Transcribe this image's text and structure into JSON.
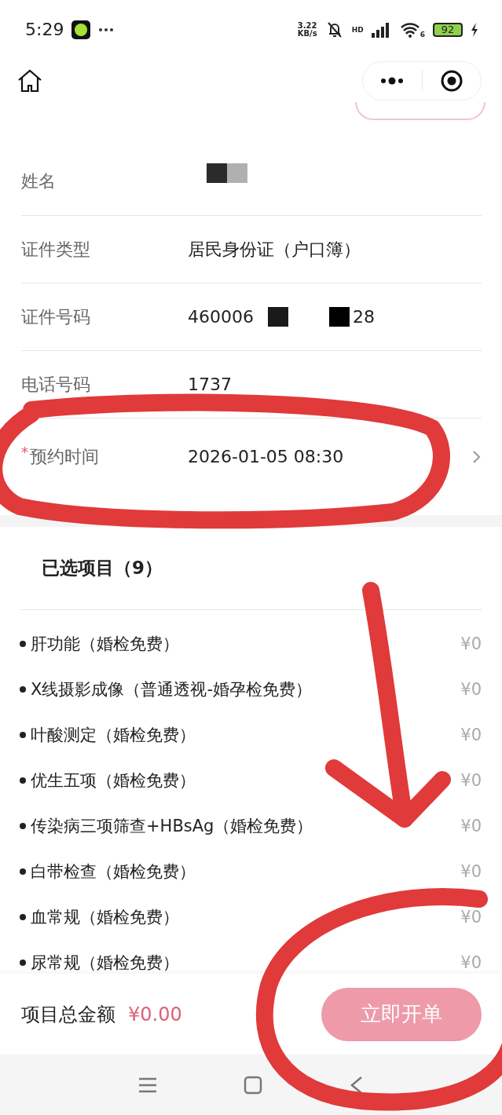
{
  "status_bar": {
    "time": "5:29",
    "net_speed": "3.22",
    "net_unit": "KB/s",
    "signal_label": "HD",
    "wifi_label": "6",
    "battery": "92"
  },
  "form": {
    "rows": [
      {
        "kind": "redacted",
        "label": "姓名",
        "chevron": false
      },
      {
        "kind": "text",
        "label": "证件类型",
        "value": "居民身份证（户口簿）",
        "chevron": false
      },
      {
        "kind": "masked",
        "label": "证件号码",
        "value": "460006",
        "tail": "28",
        "chevron": false
      },
      {
        "kind": "text",
        "label": "电话号码",
        "value": "1737",
        "chevron": false
      },
      {
        "kind": "text",
        "label": "预约时间",
        "required_mark": "*",
        "value": "2026-01-05 08:30",
        "chevron": true
      }
    ]
  },
  "selected_items": {
    "title": "已选项目（9）",
    "items": [
      {
        "name": "肝功能（婚检免费）",
        "price": "¥0"
      },
      {
        "name": "X线摄影成像（普通透视-婚孕检免费）",
        "price": "¥0"
      },
      {
        "name": "叶酸测定（婚检免费）",
        "price": "¥0"
      },
      {
        "name": "优生五项（婚检免费）",
        "price": "¥0"
      },
      {
        "name": "传染病三项筛查+HBsAg（婚检免费）",
        "price": "¥0"
      },
      {
        "name": "白带检查（婚检免费）",
        "price": "¥0"
      },
      {
        "name": "血常规（婚检免费）",
        "price": "¥0"
      },
      {
        "name": "尿常规（婚检免费）",
        "price": "¥0"
      }
    ]
  },
  "footer": {
    "total_label": "项目总金额",
    "total": "¥0.00",
    "button": "立即开单",
    "button_disabled": true
  },
  "annotations": [
    {
      "kind": "circle"
    },
    {
      "kind": "arrow"
    },
    {
      "kind": "circle"
    }
  ]
}
